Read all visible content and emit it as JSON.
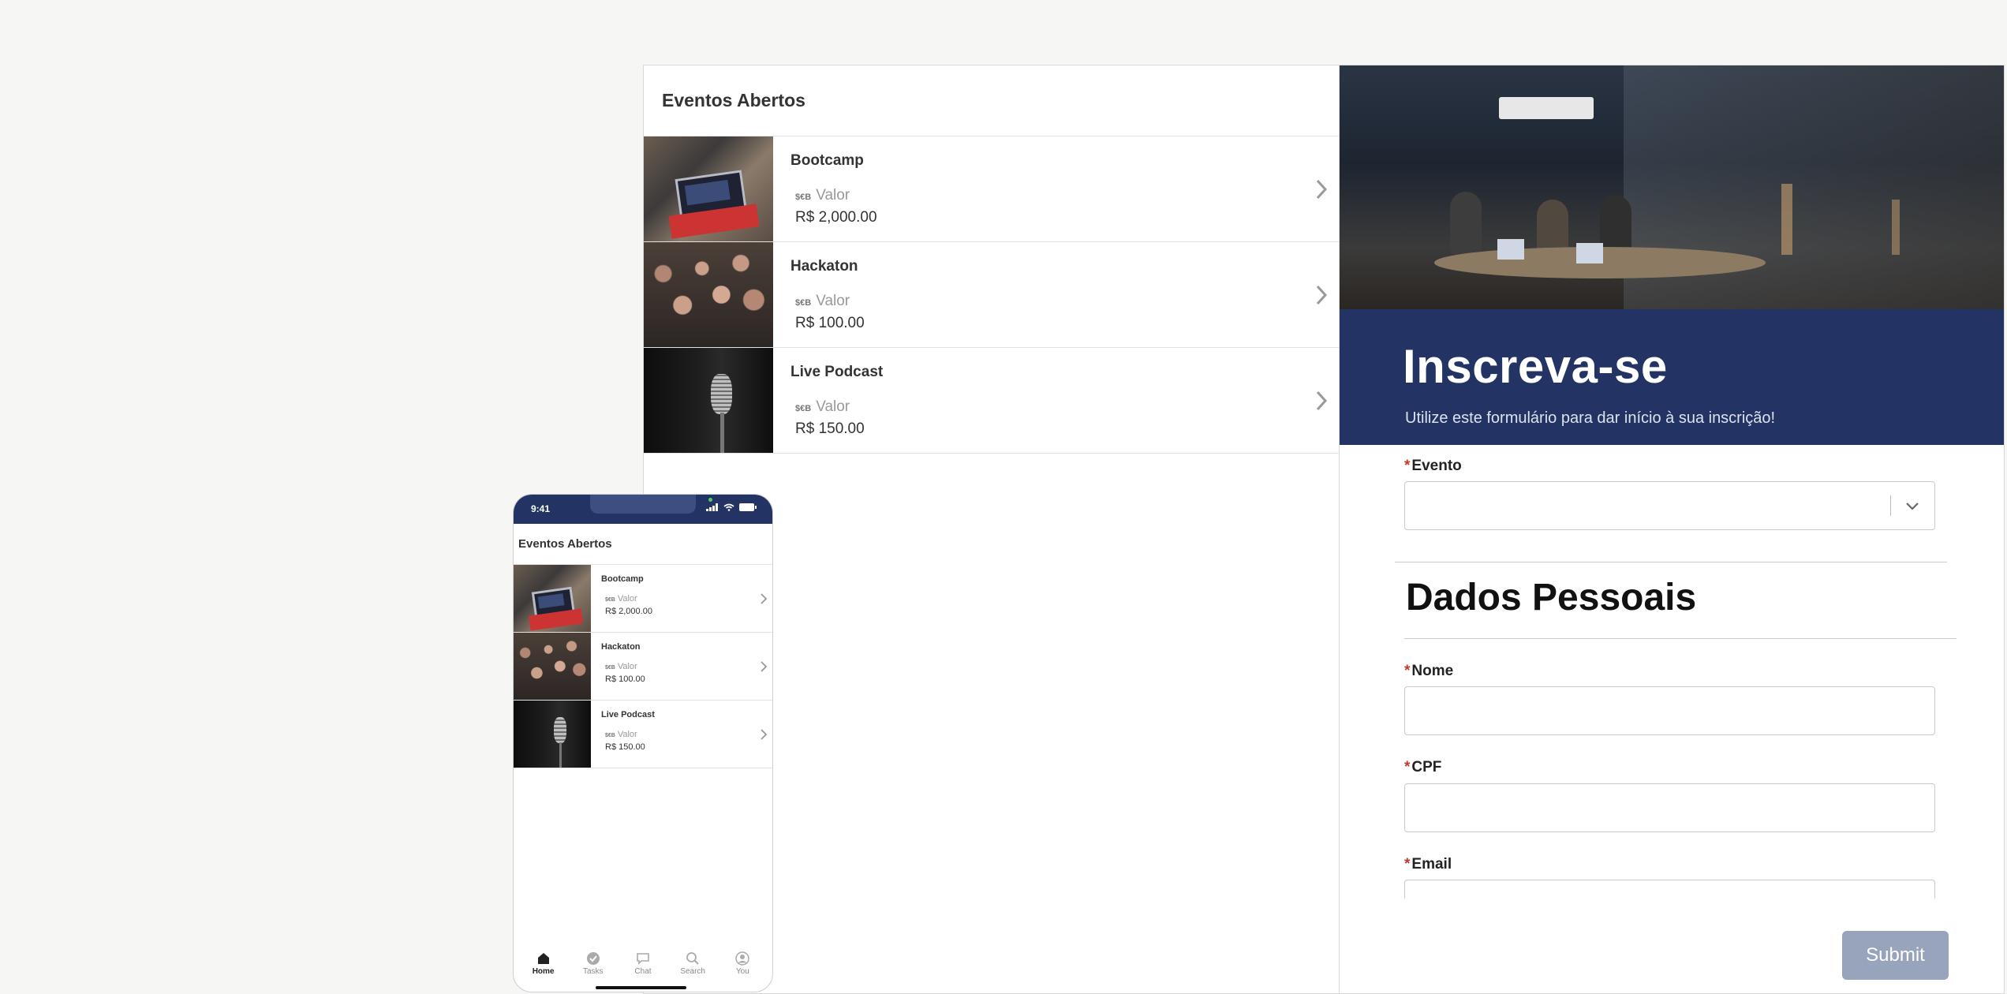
{
  "desktop_list": {
    "title": "Eventos Abertos",
    "currency_tag": "$€B",
    "value_label": "Valor",
    "events": [
      {
        "name": "Bootcamp",
        "price": "R$ 2,000.00"
      },
      {
        "name": "Hackaton",
        "price": "R$ 100.00"
      },
      {
        "name": "Live Podcast",
        "price": "R$ 150.00"
      }
    ]
  },
  "form": {
    "banner_title": "Inscreva-se",
    "banner_subtitle": "Utilize este formulário para dar início à sua inscrição!",
    "required_mark": "*",
    "evento_label": "Evento",
    "evento_value": "",
    "section_title": "Dados Pessoais",
    "nome_label": "Nome",
    "cpf_label": "CPF",
    "email_label": "Email",
    "submit_label": "Submit"
  },
  "phone": {
    "time": "9:41",
    "title": "Eventos Abertos",
    "currency_tag": "$€B",
    "value_label": "Valor",
    "events": [
      {
        "name": "Bootcamp",
        "price": "R$ 2,000.00"
      },
      {
        "name": "Hackaton",
        "price": "R$ 100.00"
      },
      {
        "name": "Live Podcast",
        "price": "R$ 150.00"
      }
    ],
    "tabs": [
      {
        "label": "Home",
        "icon": "home-icon"
      },
      {
        "label": "Tasks",
        "icon": "check-circle-icon"
      },
      {
        "label": "Chat",
        "icon": "chat-icon"
      },
      {
        "label": "Search",
        "icon": "search-icon"
      },
      {
        "label": "You",
        "icon": "user-icon"
      }
    ]
  },
  "colors": {
    "banner": "#233464",
    "submit": "#98a4bc",
    "required": "#c0392b"
  }
}
